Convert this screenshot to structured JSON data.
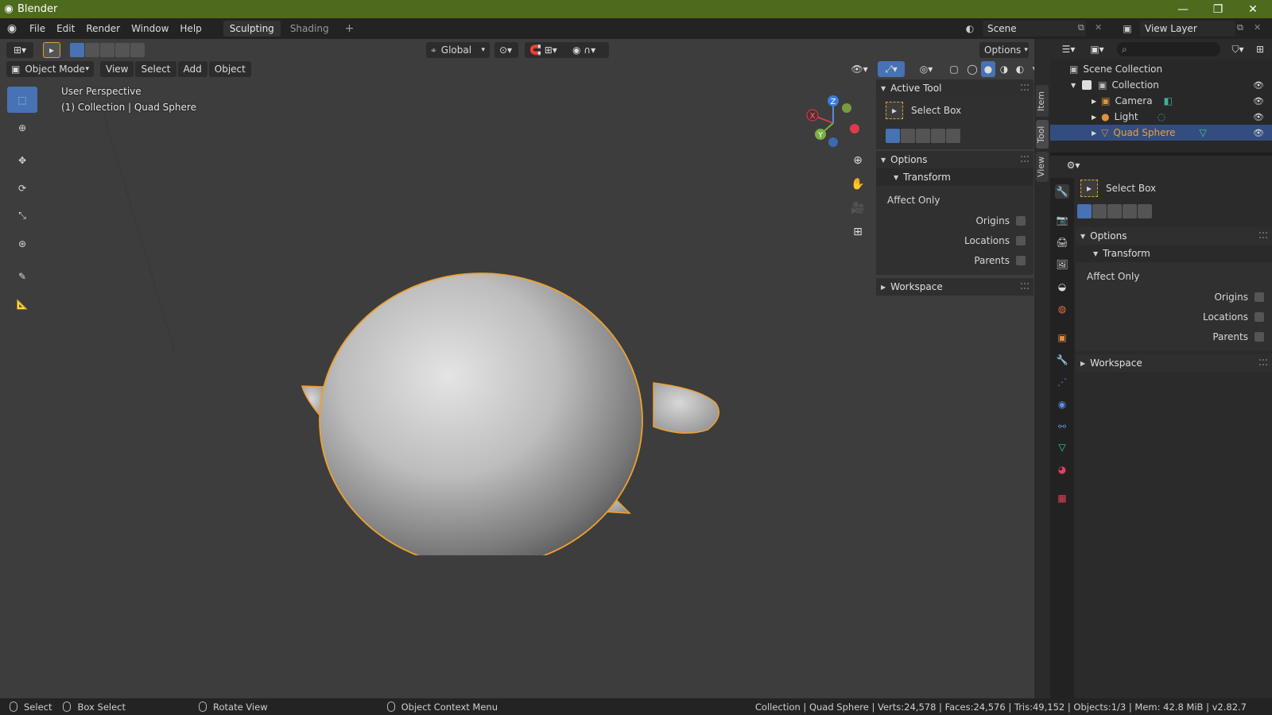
{
  "window": {
    "title": "Blender",
    "minimize": "—",
    "maximize": "❐",
    "close": "✕"
  },
  "menus": [
    "File",
    "Edit",
    "Render",
    "Window",
    "Help"
  ],
  "workspaces": [
    "Sculpting",
    "Shading",
    "+"
  ],
  "scene": {
    "name": "Scene",
    "view_layer": "View Layer"
  },
  "viewport_header": {
    "orientation": "Global",
    "options": "Options",
    "mode": "Object Mode",
    "menus": [
      "View",
      "Select",
      "Add",
      "Object"
    ]
  },
  "viewport": {
    "perspective": "User Perspective",
    "context": "(1) Collection | Quad Sphere",
    "gizmo": {
      "x": "X",
      "y": "Y",
      "z": "Z"
    }
  },
  "sidebar": {
    "tabs": [
      "Item",
      "Tool",
      "View"
    ],
    "active_tool_title": "Active Tool",
    "tool_name": "Select Box",
    "options_title": "Options",
    "transform_title": "Transform",
    "affect_only": "Affect Only",
    "origins": "Origins",
    "locations": "Locations",
    "parents": "Parents",
    "workspace": "Workspace"
  },
  "outliner": {
    "search_placeholder": "",
    "items": [
      {
        "label": "Scene Collection"
      },
      {
        "label": "Collection"
      },
      {
        "label": "Camera"
      },
      {
        "label": "Light"
      },
      {
        "label": "Quad Sphere"
      }
    ]
  },
  "properties": {
    "tool_name": "Select Box",
    "options_title": "Options",
    "transform_title": "Transform",
    "affect_only": "Affect Only",
    "origins": "Origins",
    "locations": "Locations",
    "parents": "Parents",
    "workspace": "Workspace"
  },
  "statusbar": {
    "select": "Select",
    "box_select": "Box Select",
    "rotate_view": "Rotate View",
    "context_menu": "Object Context Menu",
    "stats": "Collection | Quad Sphere | Verts:24,578 | Faces:24,576 | Tris:49,152 | Objects:1/3 | Mem: 42.8 MiB | v2.82.7"
  },
  "colors": {
    "title_bar": "#4d6a1d",
    "accent_blue": "#4772b3",
    "selection_outline": "#f0a030",
    "viewport_bg": "#3d3d3d"
  }
}
